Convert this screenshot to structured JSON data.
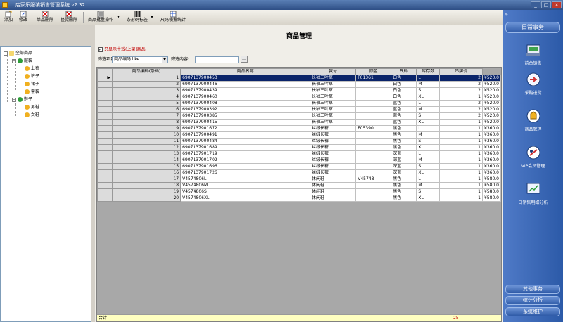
{
  "window": {
    "title": "店家乐服装销售管理系统  v2.32"
  },
  "toolbar": [
    {
      "label": "添加",
      "icon": "add-icon"
    },
    {
      "label": "修改",
      "icon": "edit-icon"
    },
    {
      "label": "单品删除",
      "icon": "delete-icon"
    },
    {
      "label": "整款删除",
      "icon": "delete-style-icon"
    },
    {
      "label": "商品批量操作",
      "icon": "batch-icon"
    },
    {
      "label": "条形码标签",
      "icon": "barcode-icon"
    },
    {
      "label": "尺码横排统计",
      "icon": "size-stats-icon"
    }
  ],
  "tree": {
    "root": "全部商品",
    "groups": [
      {
        "label": "服装",
        "children": [
          "上衣",
          "裤子",
          "裙子",
          "套装"
        ]
      },
      {
        "label": "鞋子",
        "children": [
          "男鞋",
          "女鞋"
        ]
      }
    ]
  },
  "main": {
    "title": "商品管理",
    "only_active_label": "只显示生效(上架)商品",
    "filter_item_label": "筛选项目:",
    "filter_item_value": "商品编码 like",
    "filter_content_label": "筛选内容:"
  },
  "grid": {
    "columns": [
      "商品编码(条码)",
      "商品名称",
      "款号",
      "颜色",
      "尺码",
      "库存数",
      "吊牌价"
    ],
    "rows": [
      [
        "1",
        "6907137900453",
        "长袖三叶草",
        "F01361",
        "白色",
        "L",
        "2",
        "¥520.0"
      ],
      [
        "2",
        "6907137900446",
        "长袖三叶草",
        "",
        "白色",
        "M",
        "2",
        "¥520.0"
      ],
      [
        "3",
        "6907137900439",
        "长袖三叶草",
        "",
        "白色",
        "S",
        "2",
        "¥520.0"
      ],
      [
        "4",
        "6907137900460",
        "长袖三叶草",
        "",
        "白色",
        "XL",
        "1",
        "¥520.0"
      ],
      [
        "5",
        "6907137900408",
        "长袖三叶草",
        "",
        "蓝色",
        "L",
        "2",
        "¥520.0"
      ],
      [
        "6",
        "6907137900392",
        "长袖三叶草",
        "",
        "蓝色",
        "M",
        "2",
        "¥520.0"
      ],
      [
        "7",
        "6907137900385",
        "长袖三叶草",
        "",
        "蓝色",
        "S",
        "2",
        "¥520.0"
      ],
      [
        "8",
        "6907137900415",
        "长袖三叶草",
        "",
        "蓝色",
        "XL",
        "1",
        "¥520.0"
      ],
      [
        "9",
        "6907137901672",
        "丝绒长裤",
        "F05390",
        "黑色",
        "L",
        "1",
        "¥360.0"
      ],
      [
        "10",
        "6907137900491",
        "丝绒长裤",
        "",
        "黑色",
        "M",
        "1",
        "¥360.0"
      ],
      [
        "11",
        "6907137900484",
        "丝绒长裤",
        "",
        "黑色",
        "S",
        "1",
        "¥360.0"
      ],
      [
        "12",
        "6907137901689",
        "丝绒长裤",
        "",
        "黑色",
        "XL",
        "1",
        "¥360.0"
      ],
      [
        "13",
        "6907137901719",
        "丝绒长裤",
        "",
        "深蓝",
        "L",
        "1",
        "¥360.0"
      ],
      [
        "14",
        "6907137901702",
        "丝绒长裤",
        "",
        "深蓝",
        "M",
        "1",
        "¥360.0"
      ],
      [
        "15",
        "6907137901696",
        "丝绒长裤",
        "",
        "深蓝",
        "S",
        "1",
        "¥360.0"
      ],
      [
        "16",
        "6907137901726",
        "丝绒长裤",
        "",
        "深蓝",
        "XL",
        "1",
        "¥360.0"
      ],
      [
        "17",
        "V4574806L",
        "休闲鞋",
        "V45748",
        "黑色",
        "L",
        "1",
        "¥580.0"
      ],
      [
        "18",
        "V4574806M",
        "休闲鞋",
        "",
        "黑色",
        "M",
        "1",
        "¥580.0"
      ],
      [
        "19",
        "V4574806S",
        "休闲鞋",
        "",
        "黑色",
        "S",
        "1",
        "¥580.0"
      ],
      [
        "20",
        "V4574806XL",
        "休闲鞋",
        "",
        "黑色",
        "XL",
        "1",
        "¥580.0"
      ]
    ],
    "footer_label": "合计",
    "footer_total": "25"
  },
  "right_panel": {
    "header": "日常事务",
    "items": [
      {
        "label": "前台销售",
        "icon": "pos-icon"
      },
      {
        "label": "采购进货",
        "icon": "purchase-icon"
      },
      {
        "label": "商品管理",
        "icon": "goods-icon"
      },
      {
        "label": "VIP会员管理",
        "icon": "vip-icon"
      },
      {
        "label": "日销售明细分析",
        "icon": "analysis-icon"
      }
    ],
    "bottom": [
      "其他事务",
      "统计分析",
      "系统维护"
    ]
  },
  "colors": {
    "selection": "#0a246a",
    "panel": "#3a66b5",
    "highlight": "#c00000"
  }
}
